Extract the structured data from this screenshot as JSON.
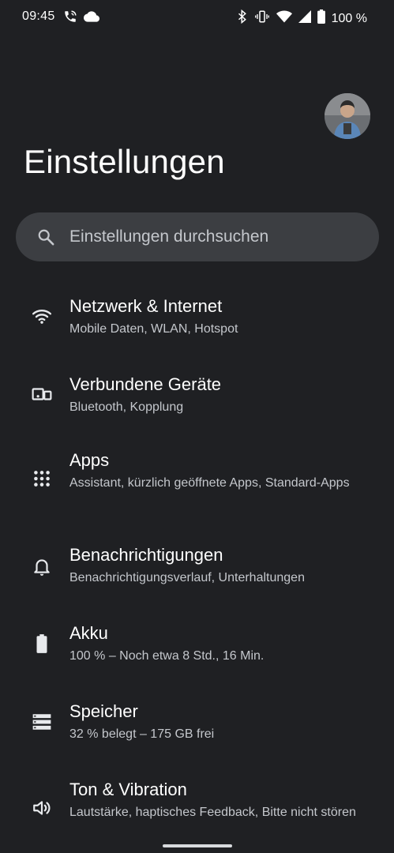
{
  "status_bar": {
    "time": "09:45",
    "battery_text": "100 %",
    "left_icons": [
      "phone-wifi-call-icon",
      "cloud-icon"
    ],
    "right_icons": [
      "bluetooth-icon",
      "vibrate-icon",
      "wifi-icon",
      "cell-signal-icon",
      "battery-icon"
    ]
  },
  "header": {
    "title": "Einstellungen"
  },
  "search": {
    "placeholder": "Einstellungen durchsuchen"
  },
  "settings": [
    {
      "title": "Netzwerk & Internet",
      "subtitle": "Mobile Daten, WLAN, Hotspot",
      "icon": "wifi-icon"
    },
    {
      "title": "Verbundene Geräte",
      "subtitle": "Bluetooth, Kopplung",
      "icon": "devices-icon"
    },
    {
      "title": "Apps",
      "subtitle": "Assistant, kürzlich geöffnete Apps, Standard-Apps",
      "icon": "apps-grid-icon"
    },
    {
      "title": "Benachrichtigungen",
      "subtitle": "Benachrichtigungsverlauf, Unterhaltungen",
      "icon": "bell-icon"
    },
    {
      "title": "Akku",
      "subtitle": "100 % – Noch etwa 8 Std., 16 Min.",
      "icon": "battery-icon"
    },
    {
      "title": "Speicher",
      "subtitle": "32 % belegt – 175 GB frei",
      "icon": "storage-icon"
    },
    {
      "title": "Ton & Vibration",
      "subtitle": "Lautstärke, haptisches Feedback, Bitte nicht stören",
      "icon": "speaker-icon"
    }
  ],
  "colors": {
    "background": "#1f2023",
    "search_background": "#3c3e42",
    "title_text": "#ffffff",
    "subtitle_text": "#c4c7cc"
  }
}
